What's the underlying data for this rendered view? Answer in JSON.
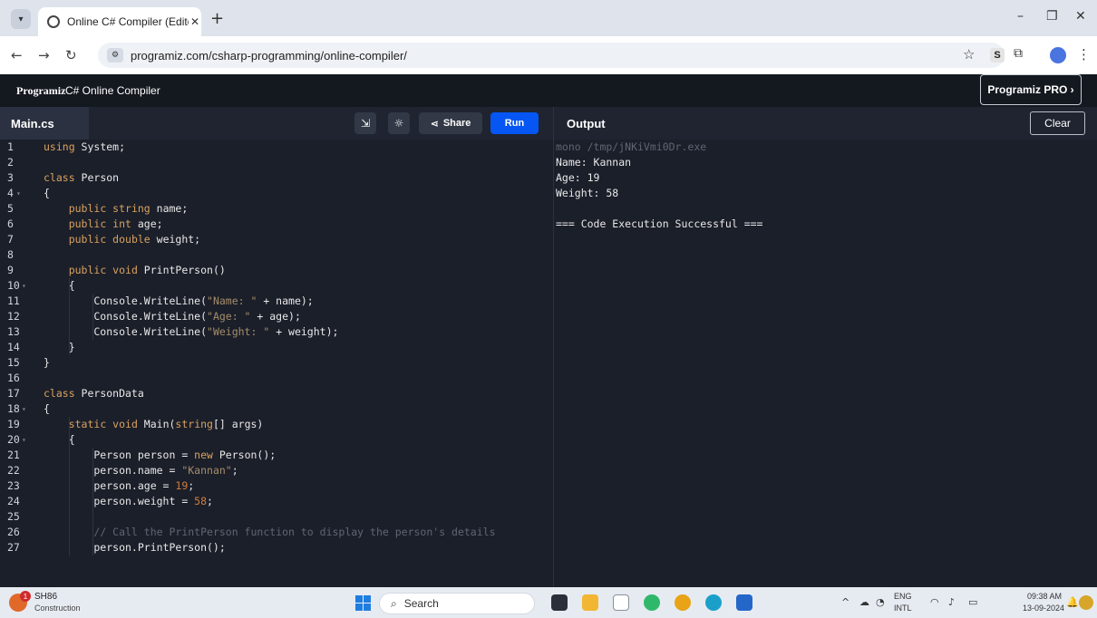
{
  "browser": {
    "tab_title": "Online C# Compiler (Editor) - P",
    "url": "programiz.com/csharp-programming/online-compiler/"
  },
  "header": {
    "logo": "Programiz",
    "title": "C# Online Compiler",
    "pro_button": "Programiz PRO ›"
  },
  "editor": {
    "file_tab": "Main.cs",
    "share_label": "Share",
    "run_label": "Run"
  },
  "output": {
    "title": "Output",
    "clear_label": "Clear",
    "lines": [
      "mono /tmp/jNKiVmi0Dr.exe",
      "Name: Kannan",
      "Age: 19",
      "Weight: 58",
      "",
      "=== Code Execution Successful ==="
    ]
  },
  "code_lines": [
    {
      "n": "1",
      "fold": false
    },
    {
      "n": "2",
      "fold": false
    },
    {
      "n": "3",
      "fold": false
    },
    {
      "n": "4",
      "fold": true
    },
    {
      "n": "5",
      "fold": false
    },
    {
      "n": "6",
      "fold": false
    },
    {
      "n": "7",
      "fold": false
    },
    {
      "n": "8",
      "fold": false
    },
    {
      "n": "9",
      "fold": false
    },
    {
      "n": "10",
      "fold": true
    },
    {
      "n": "11",
      "fold": false
    },
    {
      "n": "12",
      "fold": false
    },
    {
      "n": "13",
      "fold": false
    },
    {
      "n": "14",
      "fold": false
    },
    {
      "n": "15",
      "fold": false
    },
    {
      "n": "16",
      "fold": false
    },
    {
      "n": "17",
      "fold": false
    },
    {
      "n": "18",
      "fold": true
    },
    {
      "n": "19",
      "fold": false
    },
    {
      "n": "20",
      "fold": true
    },
    {
      "n": "21",
      "fold": false
    },
    {
      "n": "22",
      "fold": false
    },
    {
      "n": "23",
      "fold": false
    },
    {
      "n": "24",
      "fold": false
    },
    {
      "n": "25",
      "fold": false
    },
    {
      "n": "26",
      "fold": false
    },
    {
      "n": "27",
      "fold": false
    }
  ],
  "code": [
    [
      [
        "kw",
        "using"
      ],
      [
        "t",
        " System;"
      ]
    ],
    [],
    [
      [
        "kw",
        "class"
      ],
      [
        "t",
        " Person"
      ]
    ],
    [
      [
        "t",
        "{"
      ]
    ],
    [
      [
        "t",
        "    "
      ],
      [
        "kw",
        "public string"
      ],
      [
        "t",
        " name;"
      ]
    ],
    [
      [
        "t",
        "    "
      ],
      [
        "kw",
        "public int"
      ],
      [
        "t",
        " age;"
      ]
    ],
    [
      [
        "t",
        "    "
      ],
      [
        "kw",
        "public double"
      ],
      [
        "t",
        " weight;"
      ]
    ],
    [],
    [
      [
        "t",
        "    "
      ],
      [
        "kw",
        "public void"
      ],
      [
        "t",
        " PrintPerson()"
      ]
    ],
    [
      [
        "t",
        "    {"
      ]
    ],
    [
      [
        "t",
        "        Console.WriteLine("
      ],
      [
        "str",
        "\"Name: \""
      ],
      [
        "t",
        " + name);"
      ]
    ],
    [
      [
        "t",
        "        Console.WriteLine("
      ],
      [
        "str",
        "\"Age: \""
      ],
      [
        "t",
        " + age);"
      ]
    ],
    [
      [
        "t",
        "        Console.WriteLine("
      ],
      [
        "str",
        "\"Weight: \""
      ],
      [
        "t",
        " + weight);"
      ]
    ],
    [
      [
        "t",
        "    }"
      ]
    ],
    [
      [
        "t",
        "}"
      ]
    ],
    [],
    [
      [
        "kw",
        "class"
      ],
      [
        "t",
        " PersonData"
      ]
    ],
    [
      [
        "t",
        "{"
      ]
    ],
    [
      [
        "t",
        "    "
      ],
      [
        "kw",
        "static void"
      ],
      [
        "t",
        " Main("
      ],
      [
        "kw",
        "string"
      ],
      [
        "t",
        "[] args)"
      ]
    ],
    [
      [
        "t",
        "    {"
      ]
    ],
    [
      [
        "t",
        "        Person person = "
      ],
      [
        "kw",
        "new"
      ],
      [
        "t",
        " Person();"
      ]
    ],
    [
      [
        "t",
        "        person.name = "
      ],
      [
        "str",
        "\"Kannan\""
      ],
      [
        "t",
        ";"
      ]
    ],
    [
      [
        "t",
        "        person.age = "
      ],
      [
        "num",
        "19"
      ],
      [
        "t",
        ";"
      ]
    ],
    [
      [
        "t",
        "        person.weight = "
      ],
      [
        "num",
        "58"
      ],
      [
        "t",
        ";"
      ]
    ],
    [],
    [
      [
        "t",
        "        "
      ],
      [
        "cm",
        "// Call the PrintPerson function to display the person's details"
      ]
    ],
    [
      [
        "t",
        "        person.PrintPerson();"
      ]
    ]
  ],
  "taskbar": {
    "weather_badge": "1",
    "weather_title": "SH86",
    "weather_sub": "Construction",
    "search_label": "Search",
    "lang_top": "ENG",
    "lang_bottom": "INTL",
    "time": "09:38 AM",
    "date": "13-09-2024"
  }
}
